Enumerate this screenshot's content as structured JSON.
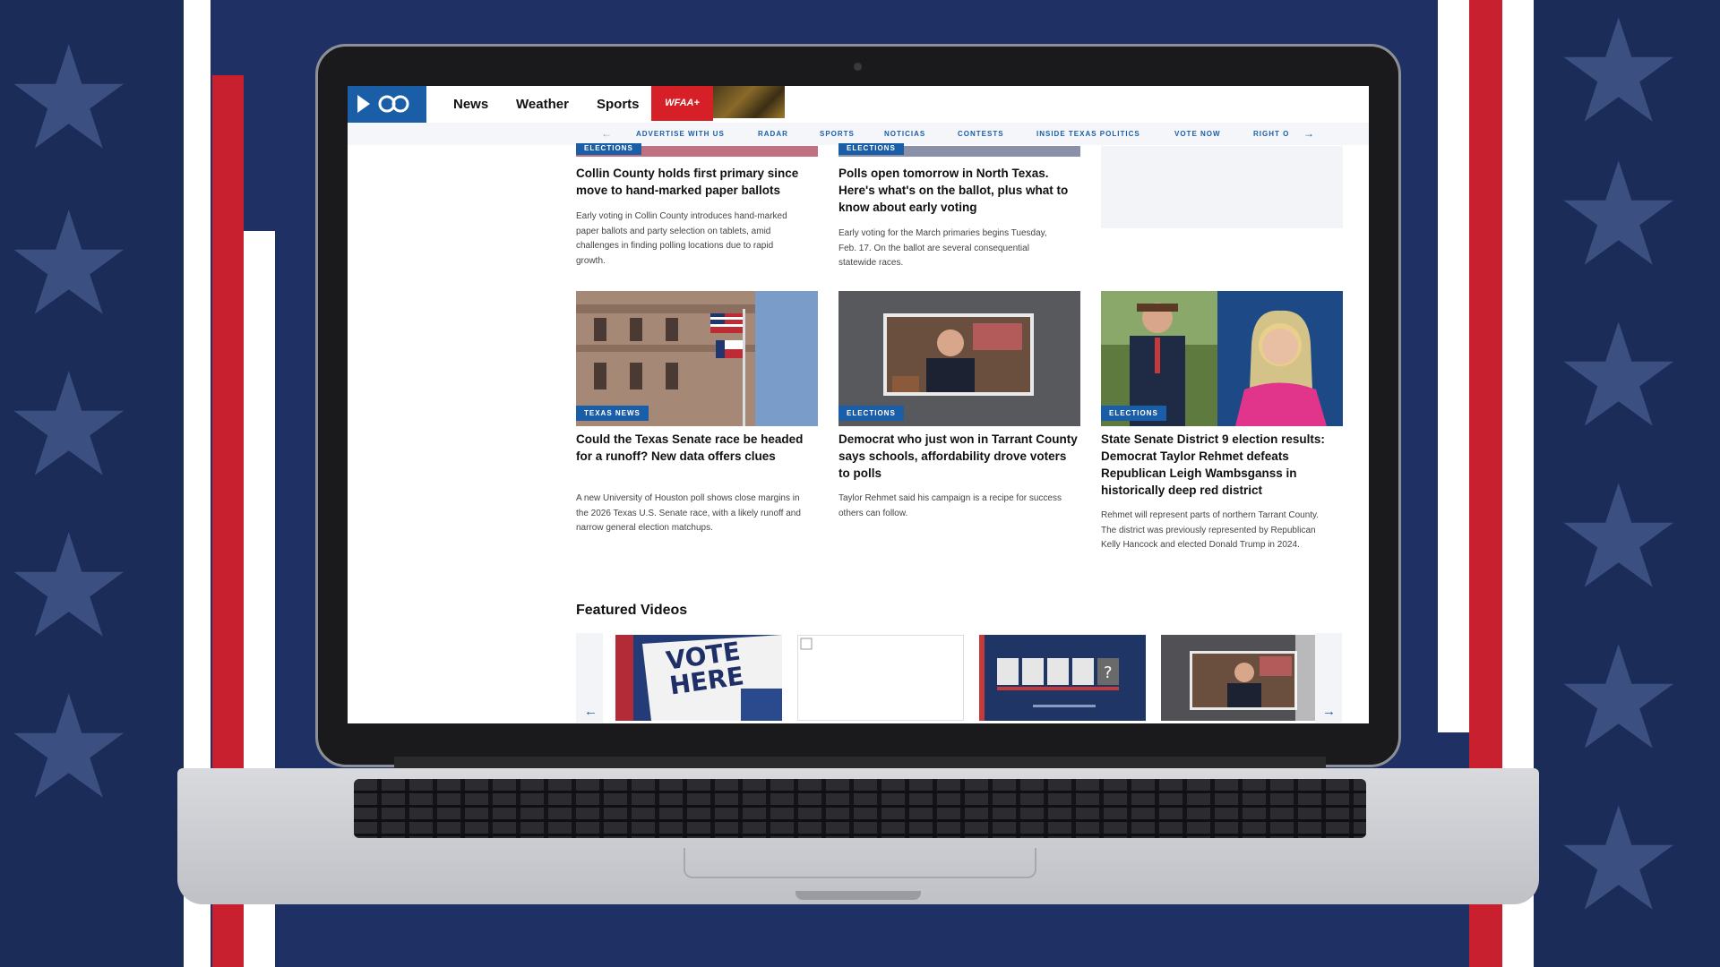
{
  "site": {
    "logo": "8",
    "nav": [
      "News",
      "Weather",
      "Sports"
    ],
    "wfaa_plus": "WFAA+",
    "subnav": [
      "ADVERTISE WITH US",
      "RADAR",
      "SPORTS",
      "NOTICIAS",
      "CONTESTS",
      "INSIDE TEXAS POLITICS",
      "VOTE NOW",
      "RIGHT O"
    ]
  },
  "top_stories": [
    {
      "tag": "ELECTIONS",
      "headline": "Collin County holds first primary since move to hand-marked paper ballots",
      "summary": "Early voting in Collin County introduces hand-marked paper ballots and party selection on tablets, amid challenges in finding polling locations due to rapid growth."
    },
    {
      "tag": "ELECTIONS",
      "headline": "Polls open tomorrow in North Texas. Here's what's on the ballot, plus what to know about early voting",
      "summary": "Early voting for the March primaries begins Tuesday, Feb. 17. On the ballot are several consequential statewide races."
    }
  ],
  "stories": [
    {
      "tag": "TEXAS NEWS",
      "headline": "Could the Texas Senate race be headed for a runoff? New data offers clues",
      "summary": "A new University of Houston poll shows close margins in the 2026 Texas U.S. Senate race, with a likely runoff and narrow general election matchups."
    },
    {
      "tag": "ELECTIONS",
      "headline": "Democrat who just won in Tarrant County says schools, affordability drove voters to polls",
      "summary": "Taylor Rehmet said his campaign is a recipe for success others can follow."
    },
    {
      "tag": "ELECTIONS",
      "headline": "State Senate District 9 election results: Democrat Taylor Rehmet defeats Republican Leigh Wambsganss in historically deep red district",
      "summary": "Rehmet will represent parts of northern Tarrant County. The district was previously represented by Republican Kelly Hancock and elected Donald Trump in 2024."
    }
  ],
  "featured": {
    "title": "Featured Videos",
    "vote_here": "VOTE HERE"
  },
  "colors": {
    "brand_blue": "#1b5ea8",
    "wfaa_red": "#d61f26",
    "flag_red": "#c8202f",
    "bg_navy": "#1c2c58"
  }
}
